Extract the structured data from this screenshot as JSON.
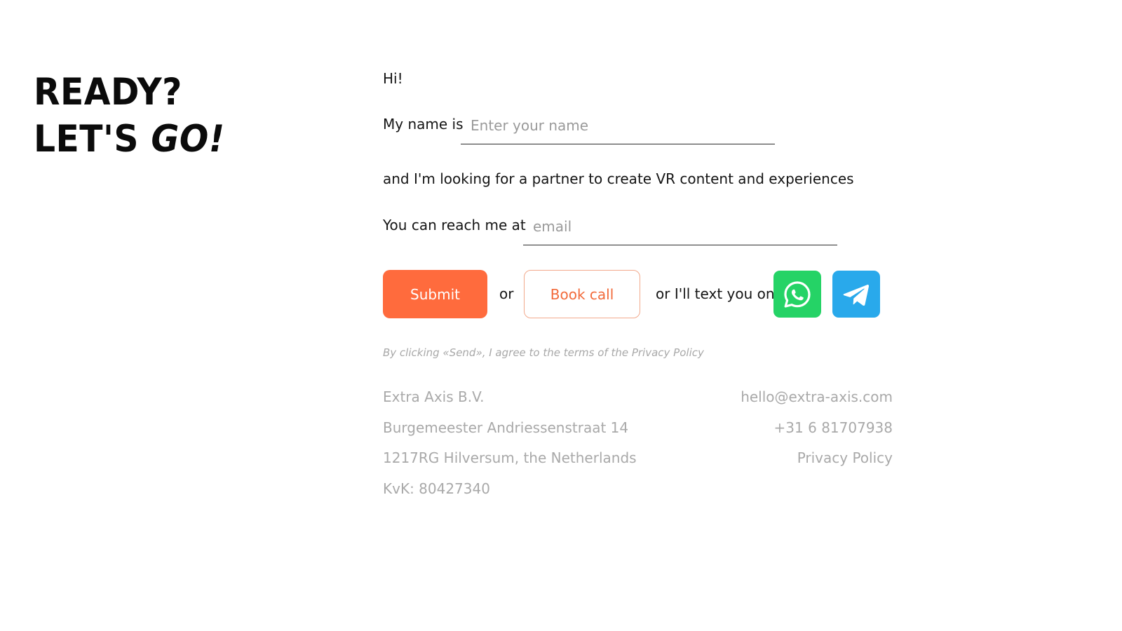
{
  "headline": {
    "line1": "READY?",
    "line2_a": "LET'S ",
    "line2_b": "GO!"
  },
  "form": {
    "greeting": "Hi!",
    "name_label": "My name is",
    "name_placeholder": "Enter your name",
    "looking_text": "and I'm looking for a partner to create VR content and experiences",
    "reach_label": "You can reach me at",
    "email_placeholder": "email",
    "submit_label": "Submit",
    "or_label": "or",
    "book_call_label": "Book call",
    "text_you_label": "or I'll text you on",
    "consent_text": "By clicking «Send», I agree to the terms of the Privacy Policy"
  },
  "messengers": [
    {
      "name": "whatsapp-icon",
      "color": "#25d366"
    },
    {
      "name": "telegram-icon",
      "color": "#29a9eb"
    }
  ],
  "footer": {
    "company": "Extra Axis B.V.",
    "street": "Burgemeester Andriessenstraat 14",
    "city": "1217RG Hilversum, the Netherlands",
    "kvk": "KvK: 80427340",
    "email": "hello@extra-axis.com",
    "phone": "+31 6 81707938",
    "privacy": "Privacy Policy"
  },
  "colors": {
    "accent": "#ff6b3d",
    "muted_text": "#a9a9a9"
  }
}
